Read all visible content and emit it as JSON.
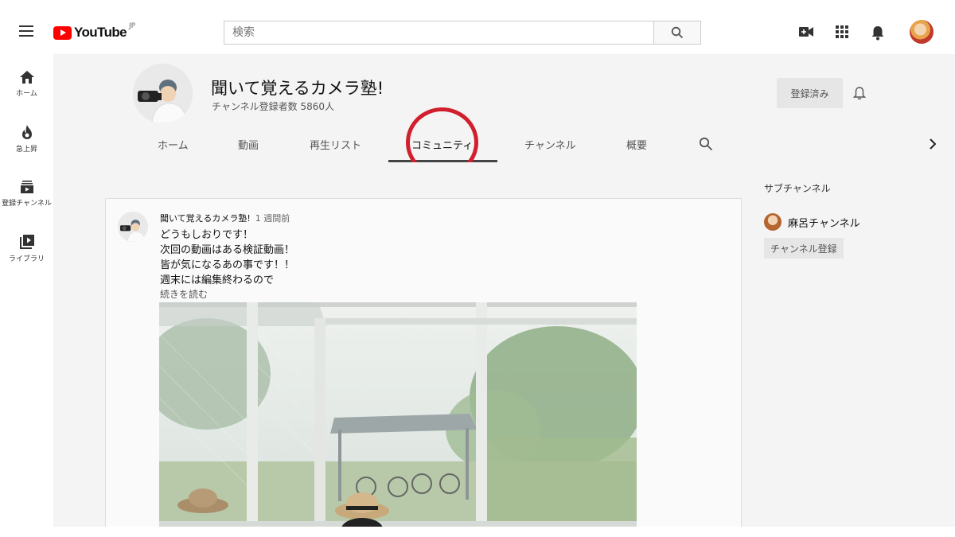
{
  "header": {
    "logo_text": "YouTube",
    "logo_region": "JP",
    "search_placeholder": "検索"
  },
  "leftnav": {
    "items": [
      {
        "label": "ホーム",
        "icon": "home-icon"
      },
      {
        "label": "急上昇",
        "icon": "flame-icon"
      },
      {
        "label": "登録チャンネル",
        "icon": "subscriptions-icon"
      },
      {
        "label": "ライブラリ",
        "icon": "library-icon"
      }
    ]
  },
  "channel": {
    "title": "聞いて覚えるカメラ塾!",
    "subscribers": "チャンネル登録者数 5860人",
    "subscribe_label": "登録済み",
    "tabs": [
      "ホーム",
      "動画",
      "再生リスト",
      "コミュニティ",
      "チャンネル",
      "概要"
    ],
    "active_tab": "コミュニティ"
  },
  "post": {
    "author": "聞いて覚えるカメラ塾!",
    "time": "1 週間前",
    "lines": [
      "どうもしおりです！",
      "次回の動画はある検証動画！",
      "皆が気になるあの事です！！",
      "週末には編集終わるので"
    ],
    "read_more": "続きを読む"
  },
  "sidebar": {
    "title": "サブチャンネル",
    "channel_name": "麻呂チャンネル",
    "subscribe_label": "チャンネル登録"
  },
  "colors": {
    "brand_red": "#ff0000",
    "annotation_red": "#d21f2d",
    "header_bg": "#f4f4f4"
  }
}
